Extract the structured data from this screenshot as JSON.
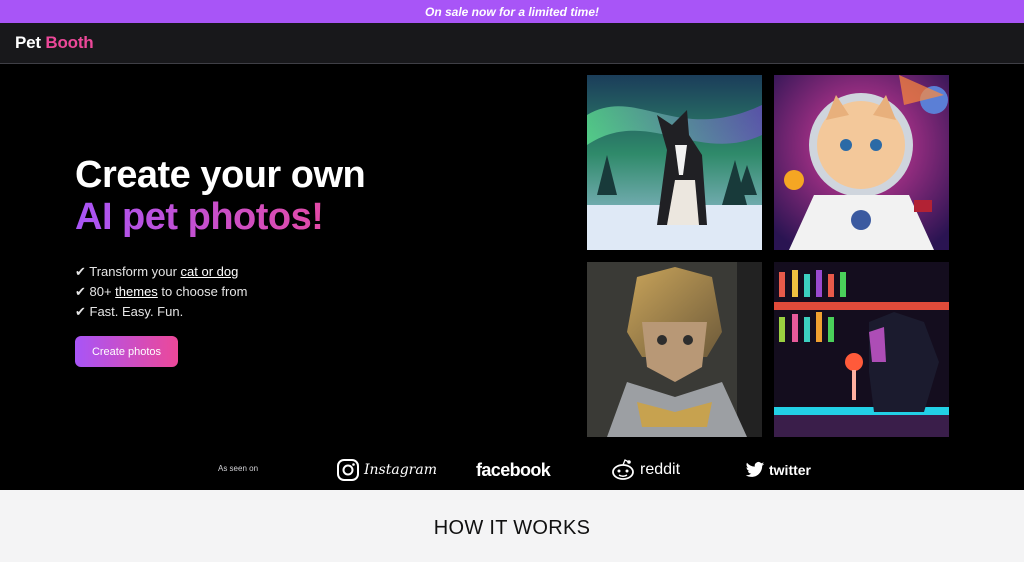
{
  "promo": {
    "text": "On sale now for a limited time!"
  },
  "nav": {
    "brand_part1": "Pet",
    "brand_part2": "Booth"
  },
  "hero": {
    "title_line1": "Create your own",
    "title_line2": "AI pet photos!",
    "bullets": [
      {
        "prefix": "✔ Transform your ",
        "link": "cat or dog",
        "suffix": ""
      },
      {
        "prefix": "✔ 80+ ",
        "link": "themes",
        "suffix": " to choose from"
      },
      {
        "prefix": "✔ Fast. Easy. Fun.",
        "link": "",
        "suffix": ""
      }
    ],
    "cta_label": "Create photos"
  },
  "gallery": {
    "images": [
      {
        "icon": "dog-aurora-image"
      },
      {
        "icon": "cat-astronaut-image"
      },
      {
        "icon": "cat-knight-image"
      },
      {
        "icon": "dog-bar-image"
      }
    ]
  },
  "press": {
    "label": "As seen on",
    "logos": [
      {
        "name": "instagram",
        "text": "Instagram"
      },
      {
        "name": "facebook",
        "text": "facebook"
      },
      {
        "name": "reddit",
        "text": "reddit"
      },
      {
        "name": "twitter",
        "text": "twitter"
      }
    ]
  },
  "how_it_works": {
    "heading": "HOW IT WORKS"
  },
  "colors": {
    "accent_purple": "#a855f7",
    "accent_pink": "#ec4899",
    "background": "#000000"
  }
}
